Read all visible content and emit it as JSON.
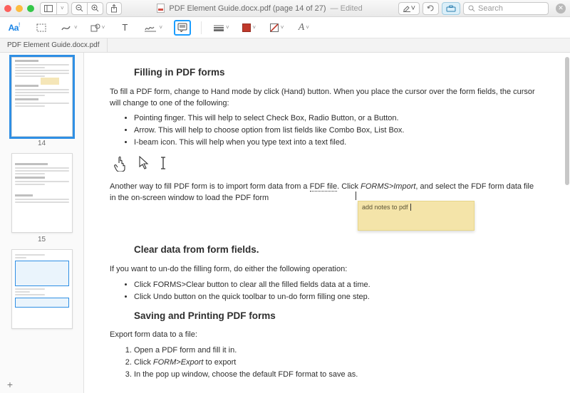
{
  "titlebar": {
    "doc_icon": "pdf",
    "title": "PDF Element Guide.docx.pdf (page 14 of 27)",
    "edited_label": "— Edited",
    "search_placeholder": "Search"
  },
  "secondary_toolbar": {
    "items": [
      {
        "name": "text-markup",
        "label": "Aa!"
      },
      {
        "name": "select-rect-tool"
      },
      {
        "name": "draw-tool"
      },
      {
        "name": "shape-tool"
      },
      {
        "name": "text-tool",
        "label": "T"
      },
      {
        "name": "signature-tool"
      },
      {
        "name": "note-tool",
        "highlight": true
      },
      {
        "name": "line-style"
      },
      {
        "name": "fill-color"
      },
      {
        "name": "stroke-style"
      },
      {
        "name": "font-style",
        "label": "A"
      }
    ]
  },
  "tabs": [
    {
      "label": "PDF Element Guide.docx.pdf"
    }
  ],
  "sidebar": {
    "pages": [
      {
        "number": "14",
        "selected": true,
        "has_note": true
      },
      {
        "number": "15",
        "selected": false,
        "has_note": false
      },
      {
        "number": "",
        "selected": false,
        "has_note": false,
        "bluebox": true
      }
    ]
  },
  "document": {
    "h1": "Filling in PDF forms",
    "p1": "To fill a PDF form, change to Hand mode by click (Hand) button. When you place the cursor over the form fields, the cursor will change to one of the following:",
    "bullets1": [
      "Pointing finger. This will help to select Check Box, Radio Button, or a Button.",
      "Arrow. This will help to choose option from list fields like Combo Box, List Box.",
      "I-beam icon. This will help when you type text into a text filed."
    ],
    "p2_pre": "Another way to fill PDF form is to import form data from a ",
    "p2_link": "FDF file",
    "p2_mid": ". Click ",
    "p2_em": "FORMS>Import",
    "p2_post": ", and select the FDF form data file in the on-screen window to load the PDF form ",
    "sticky_text": "add notes to pdf",
    "h2": "Clear data from form fields.",
    "p3": "If you want to un-do the filling form, do either the following operation:",
    "bullets2": [
      "Click FORMS>Clear button to clear all the filled fields data at a time.",
      "Click Undo button on the quick toolbar to un-do form filling one step."
    ],
    "h3": "Saving and Printing PDF forms",
    "p4": "Export form data to a file:",
    "numlist": [
      "Open a PDF form and fill it in.",
      "Click FORM>Export to export",
      "In the pop up window, choose the default FDF format to save as."
    ]
  }
}
